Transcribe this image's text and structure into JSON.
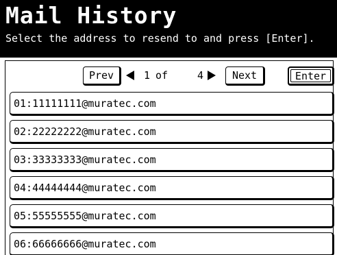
{
  "screen": {
    "title": "Mail History",
    "instruction": "Select the address to resend to and press [Enter]."
  },
  "pagination": {
    "prev_label": "Prev",
    "current": "1",
    "of_label": "of",
    "total": "4",
    "next_label": "Next",
    "prev_icon": "left-triangle-icon",
    "next_icon": "right-triangle-icon"
  },
  "enter_label": "Enter",
  "addresses": [
    "01:11111111@muratec.com",
    "02:22222222@muratec.com",
    "03:33333333@muratec.com",
    "04:44444444@muratec.com",
    "05:55555555@muratec.com",
    "06:66666666@muratec.com"
  ]
}
